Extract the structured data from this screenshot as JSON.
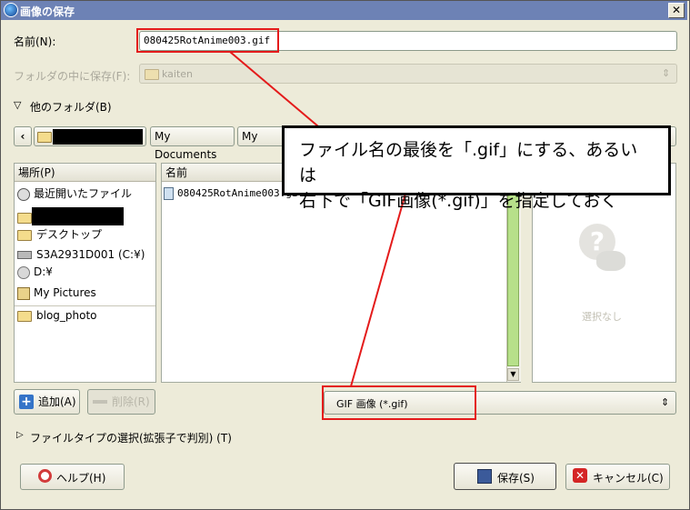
{
  "window": {
    "title": "画像の保存",
    "close_glyph": "✕"
  },
  "name_row": {
    "label": "名前(N):",
    "value": "080425RotAnime003.gif"
  },
  "save_in_row": {
    "label": "フォルダの中に保存(F):",
    "value": "kaiten",
    "arrow": "⇕"
  },
  "browse": {
    "expander_label": "他のフォルダ(B)",
    "expander_glyph": "▽"
  },
  "path_bar": {
    "back_glyph": "‹",
    "forward_glyph": "›",
    "buttons": [
      "My Documents",
      "My Web"
    ]
  },
  "places": {
    "header": "場所(P)",
    "items": [
      {
        "icon": "recent-icon",
        "label": "最近開いたファイル"
      },
      {
        "icon": "folder-icon",
        "label": ""
      },
      {
        "icon": "folder-icon",
        "label": "デスクトップ"
      },
      {
        "icon": "drive-icon",
        "label": "S3A2931D001 (C:¥)"
      },
      {
        "icon": "cdrom-icon",
        "label": "D:¥"
      },
      {
        "icon": "pictures-icon",
        "label": "My Pictures"
      },
      {
        "icon": "folder-icon",
        "label": "blog_photo"
      }
    ],
    "add_label": "追加(A)",
    "remove_label": "削除(R)"
  },
  "files": {
    "header_name": "名前",
    "rows": [
      {
        "icon": "image-file-icon",
        "name": "080425RotAnime003.gif"
      }
    ]
  },
  "preview": {
    "empty_label": "選択なし"
  },
  "filter": {
    "value": "GIF 画像 (*.gif)",
    "arrow": "⇕"
  },
  "file_type": {
    "expander_glyph": "▷",
    "label": "ファイルタイプの選択(拡張子で判別) (T)"
  },
  "buttons": {
    "help": "ヘルプ(H)",
    "save": "保存(S)",
    "cancel": "キャンセル(C)"
  },
  "annotation": {
    "line1": "ファイル名の最後を「.gif」にする、あるいは",
    "line2": "右下で「GIF画像(*.gif)」を指定しておく"
  },
  "colors": {
    "titlebar": "#6d82b5",
    "highlight": "#e41b1b",
    "scrollbar": "#b7e08a"
  }
}
